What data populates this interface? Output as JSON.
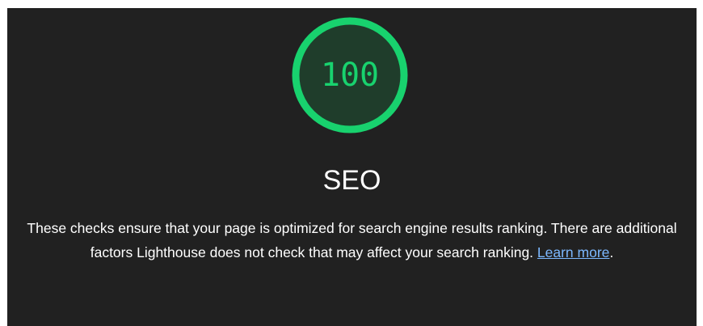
{
  "category": {
    "score": "100",
    "score_fraction": 1.0,
    "title": "SEO",
    "description": "These checks ensure that your page is optimized for search engine results ranking. There are additional factors Lighthouse does not check that may affect your search ranking.",
    "learn_more_label": "Learn more",
    "trailing_period": "."
  },
  "colors": {
    "pass_green": "#18d26e",
    "gauge_fill": "#1f3d2b",
    "panel_background": "#212121",
    "link": "#7cb8ff"
  }
}
